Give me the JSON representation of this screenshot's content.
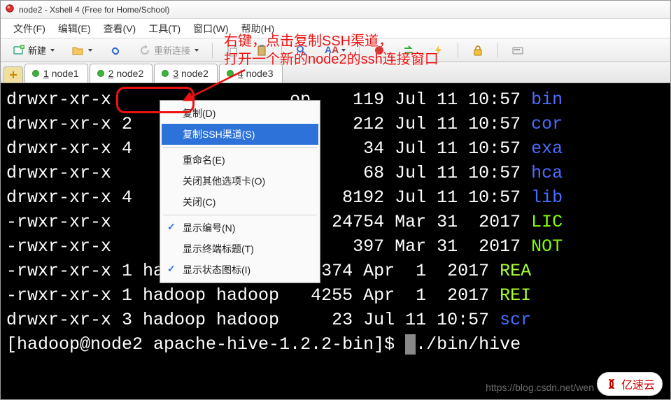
{
  "window": {
    "title": "node2 - Xshell 4 (Free for Home/School)"
  },
  "menubar": {
    "items": [
      "文件(F)",
      "编辑(E)",
      "查看(V)",
      "工具(T)",
      "窗口(W)",
      "帮助(H)"
    ]
  },
  "toolbar": {
    "new_label": "新建",
    "reconnect_label": "重新连接"
  },
  "tabs": {
    "items": [
      {
        "num": "1",
        "label": "node1"
      },
      {
        "num": "2",
        "label": "node2"
      },
      {
        "num": "3",
        "label": "node2"
      },
      {
        "num": "4",
        "label": "node3"
      }
    ]
  },
  "context_menu": {
    "copy": "复制(D)",
    "copy_ssh": "复制SSH渠道(S)",
    "rename": "重命名(E)",
    "close_others": "关闭其他选项卡(O)",
    "close": "关闭(C)",
    "show_number": "显示编号(N)",
    "show_terminal_title": "显示终端标题(T)",
    "show_status_icon": "显示状态图标(I)"
  },
  "annotation": {
    "line1": "右键，点击复制SSH渠道，",
    "line2": "打开一个新的node2的ssh连接窗口"
  },
  "terminal_lines": [
    {
      "perm": "drwxr-xr-x",
      "rest": "                 op    119 Jul 11 10:57 ",
      "tail": "bin",
      "cls": "fg-blue"
    },
    {
      "perm": "drwxr-xr-x",
      "rest": " 2               op    212 Jul 11 10:57 ",
      "tail": "cor",
      "cls": "fg-blue"
    },
    {
      "perm": "drwxr-xr-x",
      "rest": " 4               op     34 Jul 11 10:57 ",
      "tail": "exa",
      "cls": "fg-blue"
    },
    {
      "perm": "drwxr-xr-x",
      "rest": "                 op     68 Jul 11 10:57 ",
      "tail": "hca",
      "cls": "fg-blue"
    },
    {
      "perm": "drwxr-xr-x",
      "rest": " 4               op   8192 Jul 11 10:57 ",
      "tail": "lib",
      "cls": "fg-blue"
    },
    {
      "perm": "-rwxr-xr-x",
      "rest": "                 op  24754 Mar 31  2017 ",
      "tail": "LIC",
      "cls": "fg-lime"
    },
    {
      "perm": "-rwxr-xr-x",
      "rest": "                 op    397 Mar 31  2017 ",
      "tail": "NOT",
      "cls": "fg-lime"
    },
    {
      "perm": "-rwxr-xr-x",
      "rest": " 1 hadoop hadoop   4374 Apr  1  2017 ",
      "tail": "REA",
      "cls": "fg-yellow-green"
    },
    {
      "perm": "-rwxr-xr-x",
      "rest": " 1 hadoop hadoop   4255 Apr  1  2017 ",
      "tail": "REI",
      "cls": "fg-yellow-green"
    },
    {
      "perm": "drwxr-xr-x",
      "rest": " 3 hadoop hadoop     23 Jul 11 10:57 ",
      "tail": "scr",
      "cls": "fg-blue"
    }
  ],
  "prompt": {
    "text": "[hadoop@node2 apache-hive-1.2.2-bin]$ ",
    "cmd": "./bin/hive"
  },
  "watermark": "https://blog.csdn.net/wen",
  "brand": "亿速云"
}
